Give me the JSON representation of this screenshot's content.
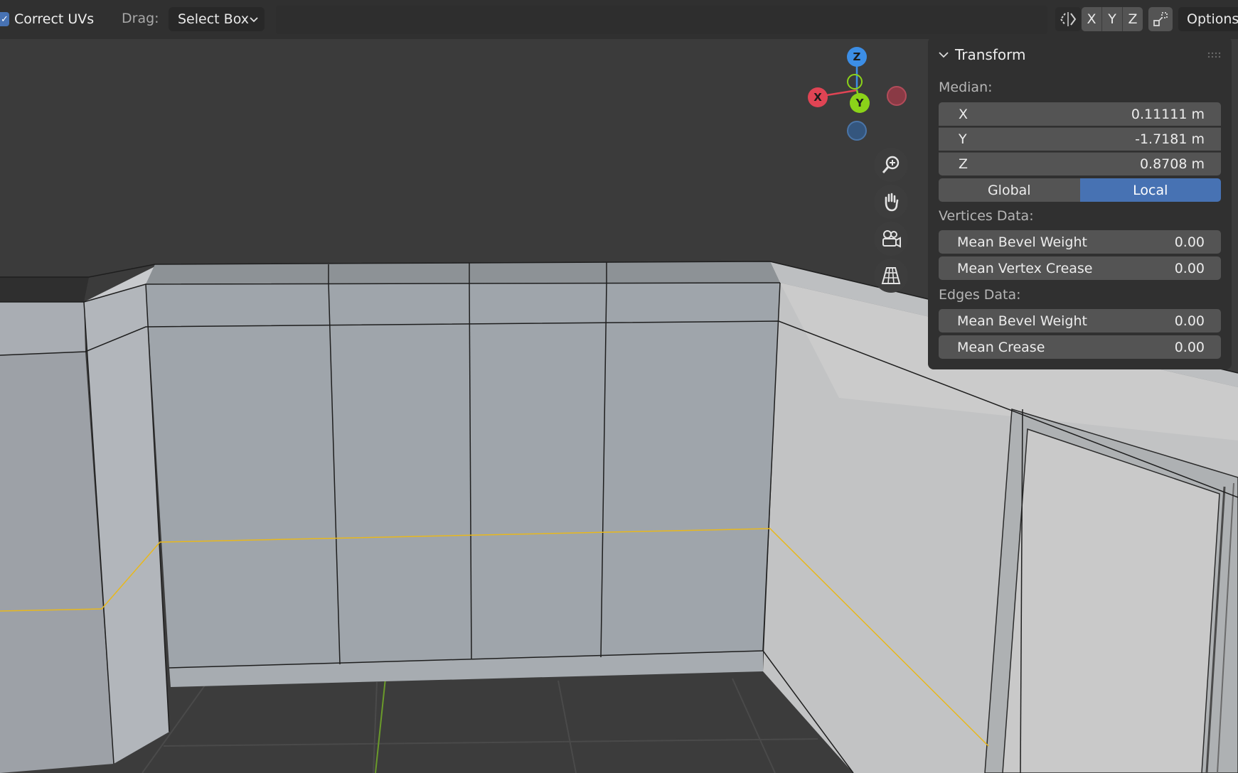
{
  "header": {
    "correct_uvs_checked": true,
    "correct_uvs_label": "Correct UVs",
    "drag_label": "Drag:",
    "drag_value": "Select Box",
    "axis_buttons": [
      "X",
      "Y",
      "Z"
    ],
    "options_label": "Options"
  },
  "gizmo": {
    "z_label": "Z",
    "x_label": "X",
    "y_label": "Y",
    "colors": {
      "x": "#e04454",
      "y": "#8bd319",
      "z": "#3c8ee6"
    }
  },
  "nav_buttons": [
    "zoom-icon",
    "pan-hand-icon",
    "camera-view-icon",
    "perspective-grid-icon"
  ],
  "panel": {
    "title": "Transform",
    "median_label": "Median:",
    "median": [
      {
        "axis": "X",
        "value": "0.11111 m"
      },
      {
        "axis": "Y",
        "value": "-1.7181 m"
      },
      {
        "axis": "Z",
        "value": "0.8708 m"
      }
    ],
    "space_options": [
      "Global",
      "Local"
    ],
    "space_selected": "Local",
    "vertices_data_label": "Vertices Data:",
    "vertices": [
      {
        "label": "Mean Bevel Weight",
        "value": "0.00"
      },
      {
        "label": "Mean Vertex Crease",
        "value": "0.00"
      }
    ],
    "edges_data_label": "Edges Data:",
    "edges": [
      {
        "label": "Mean Bevel Weight",
        "value": "0.00"
      },
      {
        "label": "Mean Crease",
        "value": "0.00"
      }
    ]
  },
  "colors": {
    "accent": "#4772b3",
    "selected_edge": "#e8b81c",
    "panel_bg": "#303030",
    "field_bg": "#545454"
  }
}
